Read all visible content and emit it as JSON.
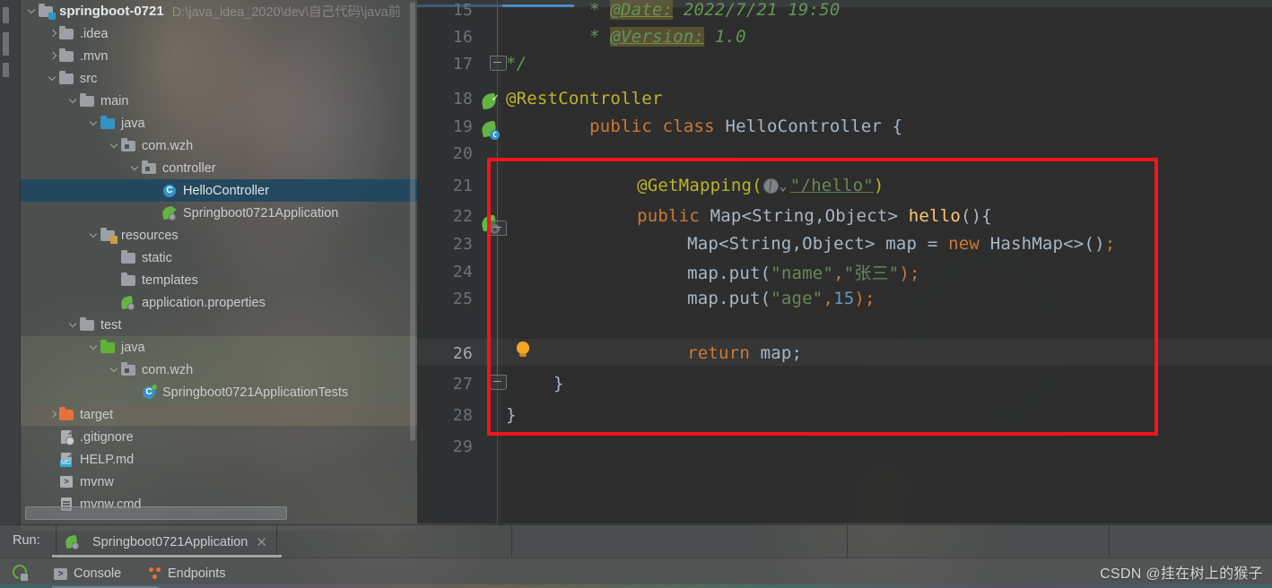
{
  "project": {
    "name": "springboot-0721",
    "path": "D:\\java_idea_2020\\dev\\自己代码\\java前",
    "tree": [
      {
        "label": ".idea",
        "indent": 1,
        "arrow": "right",
        "icon": "folder-icon"
      },
      {
        "label": ".mvn",
        "indent": 1,
        "arrow": "right",
        "icon": "folder-icon"
      },
      {
        "label": "src",
        "indent": 1,
        "arrow": "down",
        "icon": "folder-icon"
      },
      {
        "label": "main",
        "indent": 2,
        "arrow": "down",
        "icon": "folder-icon"
      },
      {
        "label": "java",
        "indent": 3,
        "arrow": "down",
        "icon": "folder-blue-icon"
      },
      {
        "label": "com.wzh",
        "indent": 4,
        "arrow": "down",
        "icon": "package-icon"
      },
      {
        "label": "controller",
        "indent": 5,
        "arrow": "down",
        "icon": "package-icon"
      },
      {
        "label": "HelloController",
        "indent": 6,
        "arrow": "none",
        "icon": "java-class-icon",
        "selected": true
      },
      {
        "label": "Springboot0721Application",
        "indent": 6,
        "arrow": "none",
        "icon": "spring-boot-icon"
      },
      {
        "label": "resources",
        "indent": 3,
        "arrow": "down",
        "icon": "folder-resources-icon"
      },
      {
        "label": "static",
        "indent": 4,
        "arrow": "none",
        "icon": "folder-icon"
      },
      {
        "label": "templates",
        "indent": 4,
        "arrow": "none",
        "icon": "folder-icon"
      },
      {
        "label": "application.properties",
        "indent": 4,
        "arrow": "none",
        "icon": "spring-config-icon"
      },
      {
        "label": "test",
        "indent": 2,
        "arrow": "down",
        "icon": "folder-icon"
      },
      {
        "label": "java",
        "indent": 3,
        "arrow": "down",
        "icon": "folder-green-icon",
        "tint": "green"
      },
      {
        "label": "com.wzh",
        "indent": 4,
        "arrow": "down",
        "icon": "package-icon",
        "tint": "green"
      },
      {
        "label": "Springboot0721ApplicationTests",
        "indent": 5,
        "arrow": "none",
        "icon": "java-test-class-icon",
        "tint": "green"
      },
      {
        "label": "target",
        "indent": 1,
        "arrow": "right",
        "icon": "folder-target-icon",
        "tint": "tan"
      },
      {
        "label": ".gitignore",
        "indent": 1,
        "arrow": "none",
        "icon": "gitignore-icon"
      },
      {
        "label": "HELP.md",
        "indent": 1,
        "arrow": "none",
        "icon": "markdown-icon"
      },
      {
        "label": "mvnw",
        "indent": 1,
        "arrow": "none",
        "icon": "shell-script-icon"
      },
      {
        "label": "mvnw.cmd",
        "indent": 1,
        "arrow": "none",
        "icon": "cmd-script-icon"
      }
    ]
  },
  "editor": {
    "file": "HelloController.java",
    "lines": [
      {
        "no": "15",
        "gutter": "none"
      },
      {
        "no": "16",
        "gutter": "none"
      },
      {
        "no": "17",
        "gutter": "fold-end"
      },
      {
        "no": "18",
        "gutter": "spring-bean-check-icon"
      },
      {
        "no": "19",
        "gutter": "spring-bean-icon"
      },
      {
        "no": "20",
        "gutter": "none"
      },
      {
        "no": "21",
        "gutter": "none"
      },
      {
        "no": "22",
        "gutter": "spring-mapping-icon"
      },
      {
        "no": "23",
        "gutter": "none"
      },
      {
        "no": "24",
        "gutter": "none"
      },
      {
        "no": "25",
        "gutter": "none"
      },
      {
        "no": "26",
        "gutter": "intention-bulb-icon",
        "current": true
      },
      {
        "no": "27",
        "gutter": "fold-end"
      },
      {
        "no": "28",
        "gutter": "none"
      },
      {
        "no": "29",
        "gutter": "none"
      }
    ],
    "code": {
      "l15_star": "*",
      "l15_tag": "@Date:",
      "l15_val": "2022/7/21 19:50",
      "l16_star": "*",
      "l16_tag": "@Version:",
      "l16_val": "1.0",
      "l17": "*/",
      "l18": "@RestController",
      "l19_kw": "public class",
      "l19_type": "HelloController",
      "l19_brace": "{",
      "l21_ann": "@GetMapping(",
      "l21_str": "\"/hello\"",
      "l21_close": ")",
      "l22_kw": "public",
      "l22_type": "Map<String,Object>",
      "l22_mth": "hello",
      "l22_tail": "(){",
      "l23_type": "Map<String,Object>",
      "l23_var": "map",
      "l23_eq": "=",
      "l23_kw": "new",
      "l23_ctor": "HashMap<>()",
      "l23_semi": ";",
      "l24_call": "map.put(",
      "l24_a1": "\"name\"",
      "l24_comma": ",",
      "l24_a2": "\"张三\"",
      "l24_tail": ");",
      "l25_call": "map.put(",
      "l25_a1": "\"age\"",
      "l25_comma": ",",
      "l25_a2": "15",
      "l25_tail": ");",
      "l26_kw": "return",
      "l26_var": "map;",
      "l27": "}",
      "l28": "}"
    },
    "highlight_box_color": "#f0151a"
  },
  "run_panel": {
    "label": "Run:",
    "configuration": "Springboot0721Application",
    "close_glyph": "✕",
    "tabs": [
      {
        "label": "Console",
        "icon": "console-icon",
        "active": true
      },
      {
        "label": "Endpoints",
        "icon": "endpoints-icon",
        "active": false
      }
    ],
    "rerun_title": "Rerun"
  },
  "watermark": "CSDN @挂在树上的猴子"
}
